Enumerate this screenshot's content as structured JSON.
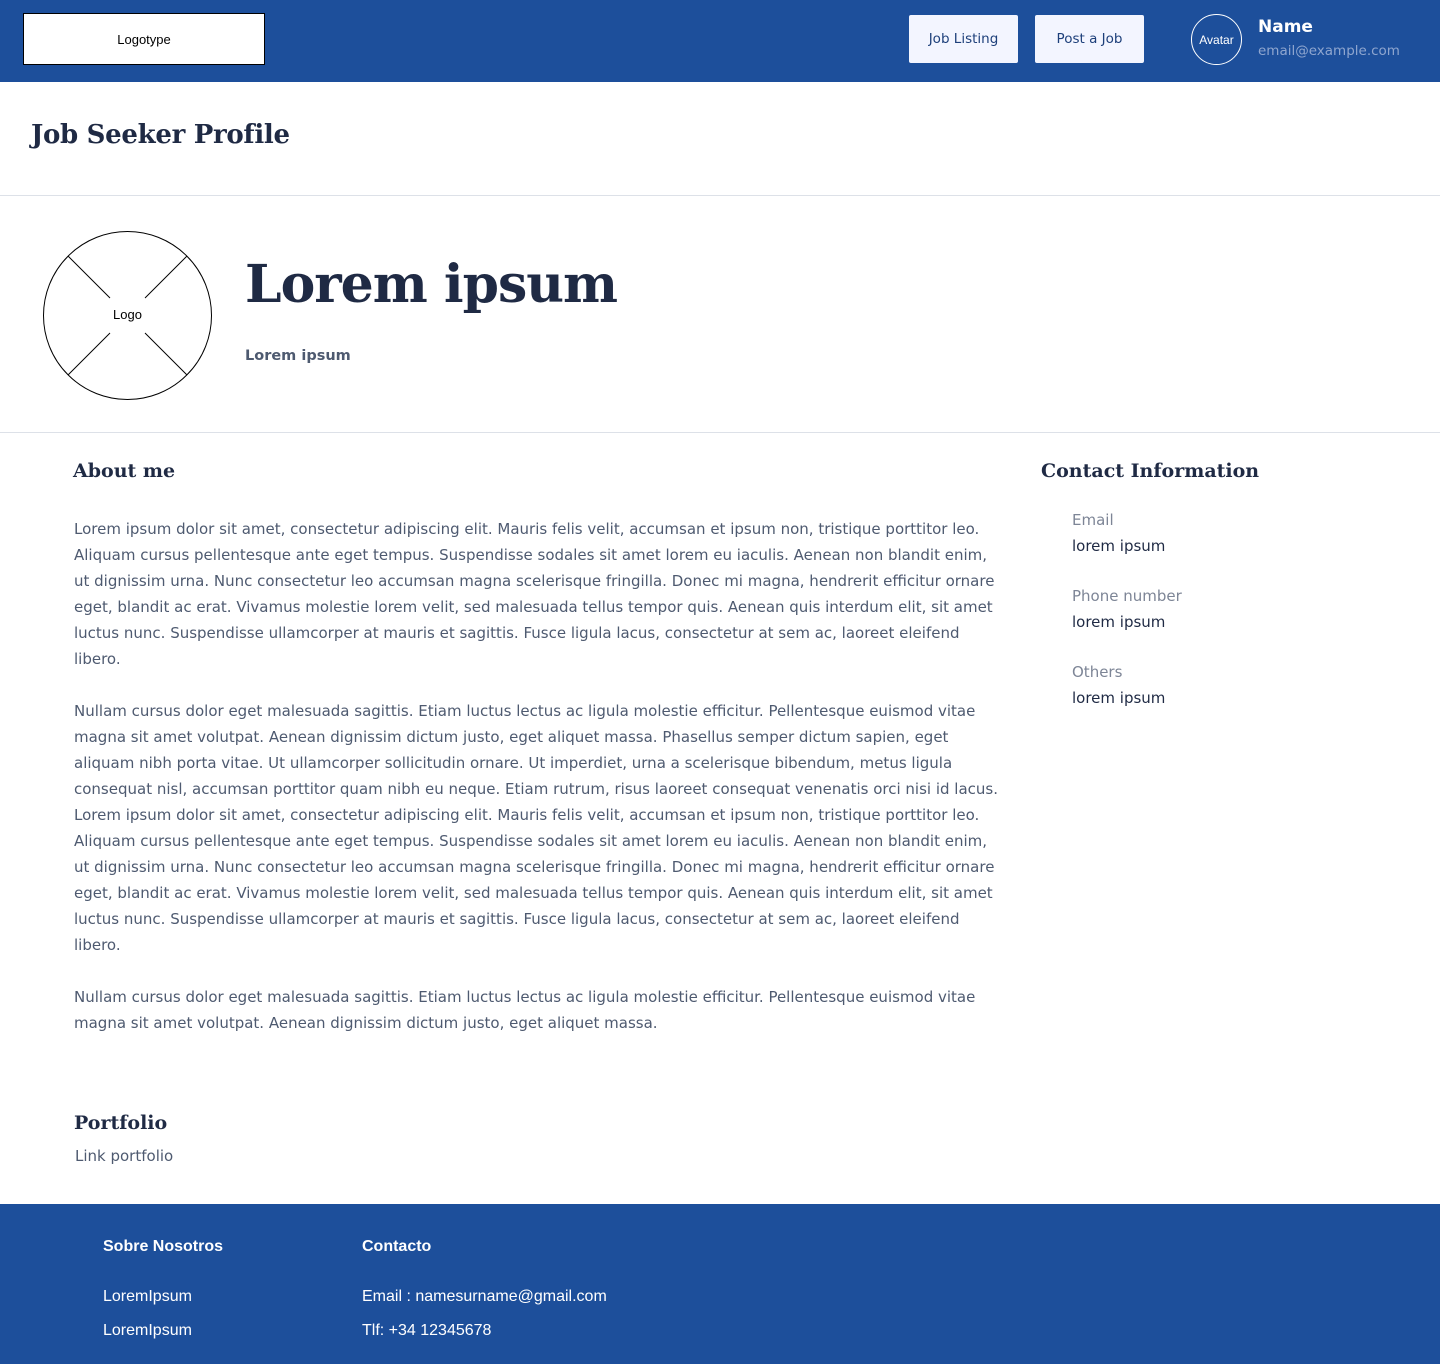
{
  "header": {
    "logotype": "Logotype",
    "nav": {
      "job_listing": "Job Listing",
      "post_job": "Post a Job"
    },
    "avatar_label": "Avatar",
    "user_name": "Name",
    "user_email": "email@example.com"
  },
  "page_title": "Job Seeker Profile",
  "profile": {
    "logo_label": "Logo",
    "name": "Lorem ipsum",
    "subtitle": "Lorem ipsum"
  },
  "about": {
    "heading": "About me",
    "paragraphs": [
      "Lorem ipsum dolor sit amet, consectetur adipiscing elit. Mauris felis velit, accumsan et ipsum non, tristique porttitor leo. Aliquam cursus pellentesque ante eget tempus. Suspendisse sodales sit amet lorem eu iaculis. Aenean non blandit enim, ut dignissim urna. Nunc consectetur leo accumsan magna scelerisque fringilla. Donec mi magna, hendrerit efficitur ornare eget, blandit ac erat. Vivamus molestie lorem velit, sed malesuada tellus tempor quis. Aenean quis interdum elit, sit amet luctus nunc. Suspendisse ullamcorper at mauris et sagittis. Fusce ligula lacus, consectetur at sem ac, laoreet eleifend libero.",
      "Nullam cursus dolor eget malesuada sagittis. Etiam luctus lectus ac ligula molestie efficitur. Pellentesque euismod vitae magna sit amet volutpat. Aenean dignissim dictum justo, eget aliquet massa. Phasellus semper dictum sapien, eget aliquam nibh porta vitae. Ut ullamcorper sollicitudin ornare. Ut imperdiet, urna a scelerisque bibendum, metus ligula consequat nisl, accumsan porttitor quam nibh eu neque. Etiam rutrum, risus laoreet consequat venenatis orci nisi id lacus.",
      "Lorem ipsum dolor sit amet, consectetur adipiscing elit. Mauris felis velit, accumsan et ipsum non, tristique porttitor leo. Aliquam cursus pellentesque ante eget tempus. Suspendisse sodales sit amet lorem eu iaculis. Aenean non blandit enim, ut dignissim urna. Nunc consectetur leo accumsan magna scelerisque fringilla. Donec mi magna, hendrerit efficitur ornare eget, blandit ac erat. Vivamus molestie lorem velit, sed malesuada tellus tempor quis. Aenean quis interdum elit, sit amet luctus nunc. Suspendisse ullamcorper at mauris et sagittis. Fusce ligula lacus, consectetur at sem ac, laoreet eleifend libero.",
      "Nullam cursus dolor eget malesuada sagittis. Etiam luctus lectus ac ligula molestie efficitur. Pellentesque euismod vitae magna sit amet volutpat. Aenean dignissim dictum justo, eget aliquet massa."
    ]
  },
  "portfolio": {
    "heading": "Portfolio",
    "link": "Link portfolio"
  },
  "contact": {
    "heading": "Contact Information",
    "email_label": "Email",
    "email_value": "lorem ipsum",
    "phone_label": "Phone number",
    "phone_value": "lorem ipsum",
    "others_label": "Others",
    "others_value": "lorem ipsum"
  },
  "footer": {
    "about_heading": "Sobre Nosotros",
    "about_items": [
      "LoremIpsum",
      "LoremIpsum"
    ],
    "contact_heading": "Contacto",
    "contact_email": "Email : namesurname@gmail.com",
    "contact_phone": "Tlf: +34 12345678"
  },
  "colors": {
    "brand_blue": "#1d4f9b",
    "button_bg": "#f3f5ff",
    "heading_text": "#1f2a44",
    "body_text": "#4e5a70"
  }
}
